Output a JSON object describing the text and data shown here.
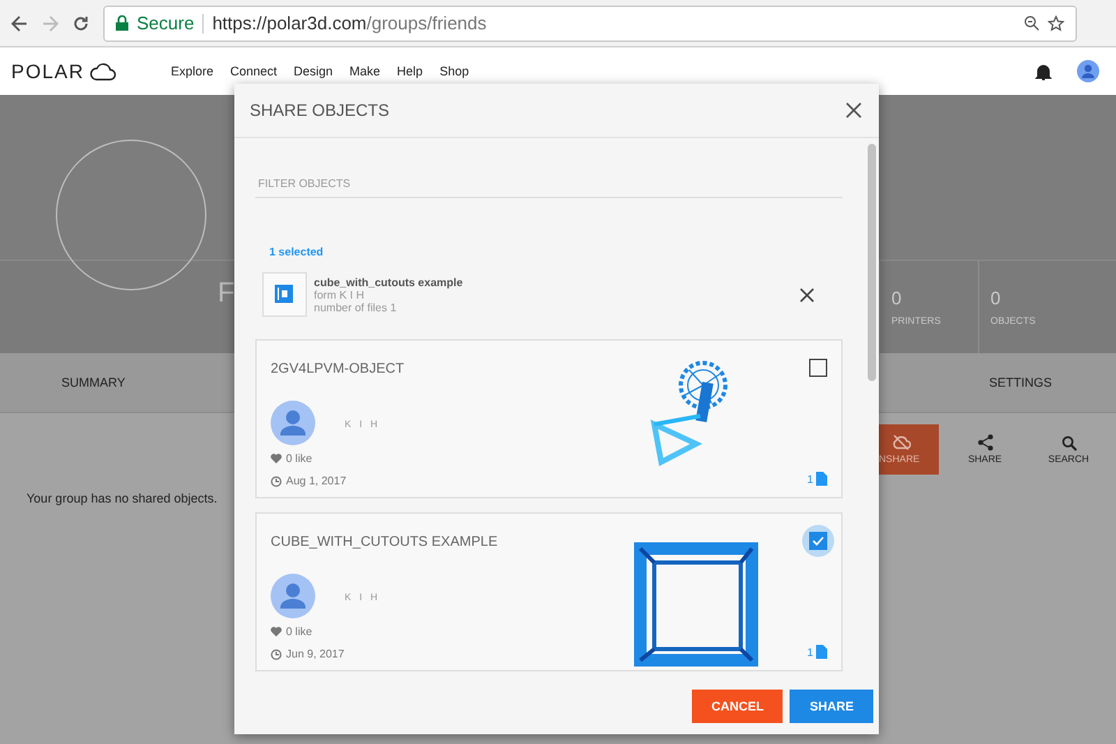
{
  "browser": {
    "secure": "Secure",
    "host": "https://polar3d.com",
    "path": "/groups/friends"
  },
  "nav": {
    "logo": "POLAR",
    "links": [
      "Explore",
      "Connect",
      "Design",
      "Make",
      "Help",
      "Shop"
    ]
  },
  "group": {
    "name": "F",
    "stats": [
      {
        "value": "0",
        "label": "PRINTERS"
      },
      {
        "value": "0",
        "label": "OBJECTS"
      }
    ]
  },
  "tabs": [
    "SUMMARY",
    "SETTINGS"
  ],
  "actions": [
    {
      "label": "NSHARE",
      "kind": "unshare"
    },
    {
      "label": "SHARE",
      "kind": "share"
    },
    {
      "label": "SEARCH",
      "kind": "search"
    }
  ],
  "empty_message": "Your group has no shared objects.",
  "dialog": {
    "title": "SHARE OBJECTS",
    "filter": {
      "placeholder": "FILTER OBJECTS"
    },
    "selected_count": "1 selected",
    "selected_items": [
      {
        "name": "cube_with_cutouts example",
        "owner": "form K I H",
        "files": "number of files 1"
      }
    ],
    "objects": [
      {
        "title": "2GV4LPVM-OBJECT",
        "owner": "K I H",
        "likes": "0 like",
        "date": "Aug 1, 2017",
        "files": "1",
        "checked": false
      },
      {
        "title": "CUBE_WITH_CUTOUTS EXAMPLE",
        "owner": "K I H",
        "likes": "0 like",
        "date": "Jun 9, 2017",
        "files": "1",
        "checked": true
      }
    ],
    "buttons": [
      {
        "label": "CANCEL",
        "kind": "cancel"
      },
      {
        "label": "SHARE",
        "kind": "primary"
      }
    ]
  }
}
